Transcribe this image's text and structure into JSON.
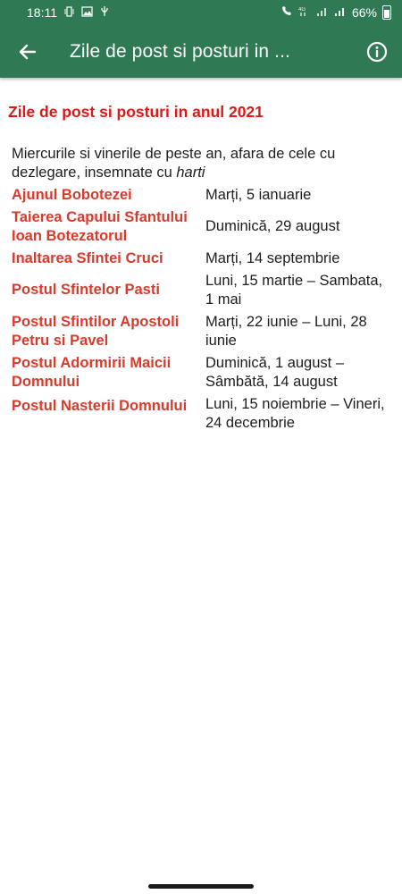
{
  "status_bar": {
    "time": "18:11",
    "left_icons": [
      "phone-vibrate-icon",
      "image-icon",
      "usb-icon"
    ],
    "right_icons": [
      "wifi-calling-icon",
      "4g-icon",
      "signal-icon",
      "signal-icon-2"
    ],
    "battery": "66%"
  },
  "app_bar": {
    "title": "Zile de post si posturi in ...",
    "back_icon": "arrow-back-icon",
    "info_icon": "info-icon",
    "color": "#2f7a55"
  },
  "content": {
    "heading": "Zile de post si posturi in anul 2021",
    "intro_text": "Miercurile si vinerile de peste an, afara de cele cu dezlegare, insemnate cu ",
    "intro_emphasis": "harti",
    "rows": [
      {
        "name": "Ajunul Bobotezei",
        "date": "Marți, 5 ianuarie"
      },
      {
        "name": "Taierea Capului Sfantului Ioan Botezatorul",
        "date": "Duminică, 29 august"
      },
      {
        "name": "Inaltarea Sfintei Cruci",
        "date": "Marți, 14 septembrie"
      },
      {
        "name": "Postul Sfintelor Pasti",
        "date": "Luni, 15 martie – Sambata, 1 mai"
      },
      {
        "name": "Postul Sfintilor Apostoli Petru si Pavel",
        "date": "Marți, 22 iunie – Luni, 28 iunie"
      },
      {
        "name": "Postul Adormirii Maicii Domnului",
        "date": "Duminică, 1 august – Sâmbătă, 14 august"
      },
      {
        "name": "Postul Nasterii Domnului",
        "date": "Luni, 15 noiembrie – Vineri, 24 decembrie"
      }
    ],
    "heading_color": "#e01818",
    "name_color": "#d83a2c"
  }
}
